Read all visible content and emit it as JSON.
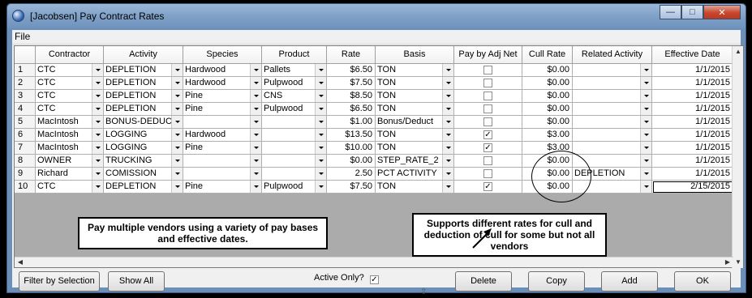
{
  "window": {
    "title": "[Jacobsen] Pay Contract Rates"
  },
  "menu": {
    "file": "File"
  },
  "grid": {
    "columns": [
      "",
      "Contractor",
      "Activity",
      "Species",
      "Product",
      "Rate",
      "Basis",
      "Pay by Adj Net",
      "Cull Rate",
      "Related Activity",
      "Effective Date"
    ],
    "rows": [
      {
        "n": "1",
        "contractor": "CTC",
        "activity": "DEPLETION",
        "species": "Hardwood",
        "product": "Pallets",
        "rate": "$6.50",
        "basis": "TON",
        "adj": false,
        "cull": "$0.00",
        "related": "",
        "date": "1/1/2015"
      },
      {
        "n": "2",
        "contractor": "CTC",
        "activity": "DEPLETION",
        "species": "Hardwood",
        "product": "Pulpwood",
        "rate": "$7.50",
        "basis": "TON",
        "adj": false,
        "cull": "$0.00",
        "related": "",
        "date": "1/1/2015"
      },
      {
        "n": "3",
        "contractor": "CTC",
        "activity": "DEPLETION",
        "species": "Pine",
        "product": "CNS",
        "rate": "$8.50",
        "basis": "TON",
        "adj": false,
        "cull": "$0.00",
        "related": "",
        "date": "1/1/2015"
      },
      {
        "n": "4",
        "contractor": "CTC",
        "activity": "DEPLETION",
        "species": "Pine",
        "product": "Pulpwood",
        "rate": "$6.50",
        "basis": "TON",
        "adj": false,
        "cull": "$0.00",
        "related": "",
        "date": "1/1/2015"
      },
      {
        "n": "5",
        "contractor": "MacIntosh",
        "activity": "BONUS-DEDUC",
        "species": "",
        "product": "",
        "rate": "$1.00",
        "basis": "Bonus/Deduct",
        "adj": false,
        "cull": "$0.00",
        "related": "",
        "date": "1/1/2015"
      },
      {
        "n": "6",
        "contractor": "MacIntosh",
        "activity": "LOGGING",
        "species": "Hardwood",
        "product": "",
        "rate": "$13.50",
        "basis": "TON",
        "adj": true,
        "cull": "$3.00",
        "related": "",
        "date": "1/1/2015"
      },
      {
        "n": "7",
        "contractor": "MacIntosh",
        "activity": "LOGGING",
        "species": "Pine",
        "product": "",
        "rate": "$10.00",
        "basis": "TON",
        "adj": true,
        "cull": "$3.00",
        "related": "",
        "date": "1/1/2015"
      },
      {
        "n": "8",
        "contractor": "OWNER",
        "activity": "TRUCKING",
        "species": "",
        "product": "",
        "rate": "$0.00",
        "basis": "STEP_RATE_2",
        "adj": false,
        "cull": "$0.00",
        "related": "",
        "date": "1/1/2015"
      },
      {
        "n": "9",
        "contractor": "Richard",
        "activity": "COMISSION",
        "species": "",
        "product": "",
        "rate": "2.50",
        "basis": "PCT ACTIVITY",
        "adj": false,
        "cull": "$0.00",
        "related": "DEPLETION",
        "date": "1/1/2015"
      },
      {
        "n": "10",
        "contractor": "CTC",
        "activity": "DEPLETION",
        "species": "Pine",
        "product": "Pulpwood",
        "rate": "$7.50",
        "basis": "TON",
        "adj": true,
        "cull": "$0.00",
        "related": "",
        "date": "2/15/2015"
      }
    ]
  },
  "callouts": {
    "left": "Pay multiple vendors using a variety of pay bases and effective dates.",
    "right": "Supports different rates for cull and deduction of cull for some but not all vendors"
  },
  "buttons": {
    "filter": "Filter by Selection",
    "show_all": "Show All",
    "active_only": "Active Only?",
    "active_only_checked": true,
    "delete": "Delete",
    "copy": "Copy",
    "add": "Add",
    "ok": "OK"
  }
}
